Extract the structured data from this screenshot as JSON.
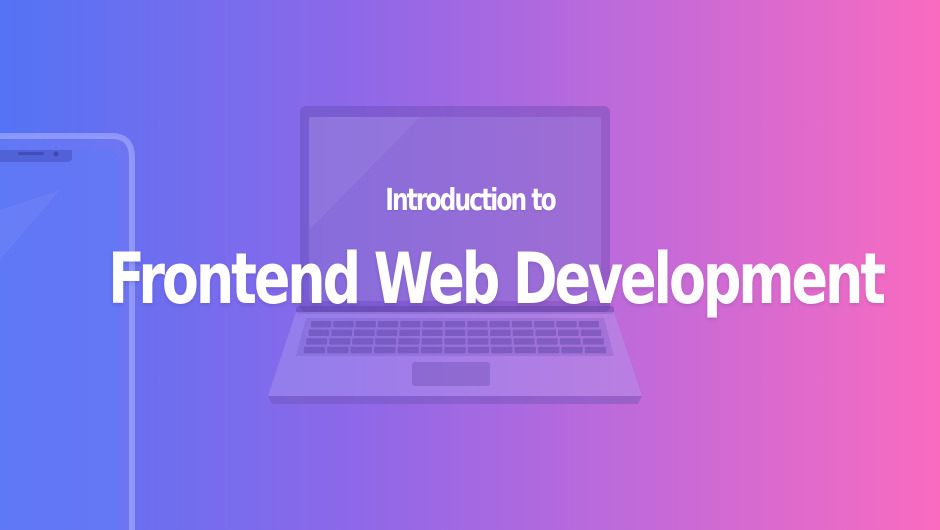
{
  "banner": {
    "subtitle": "Introduction to",
    "headline": "Frontend Web Development"
  },
  "colors": {
    "gradient_start": "#5473f5",
    "gradient_mid": "#8e68e8",
    "gradient_end": "#fa6bbf",
    "text": "#ffffff"
  },
  "icons": [
    "smartphone-icon",
    "laptop-icon"
  ]
}
